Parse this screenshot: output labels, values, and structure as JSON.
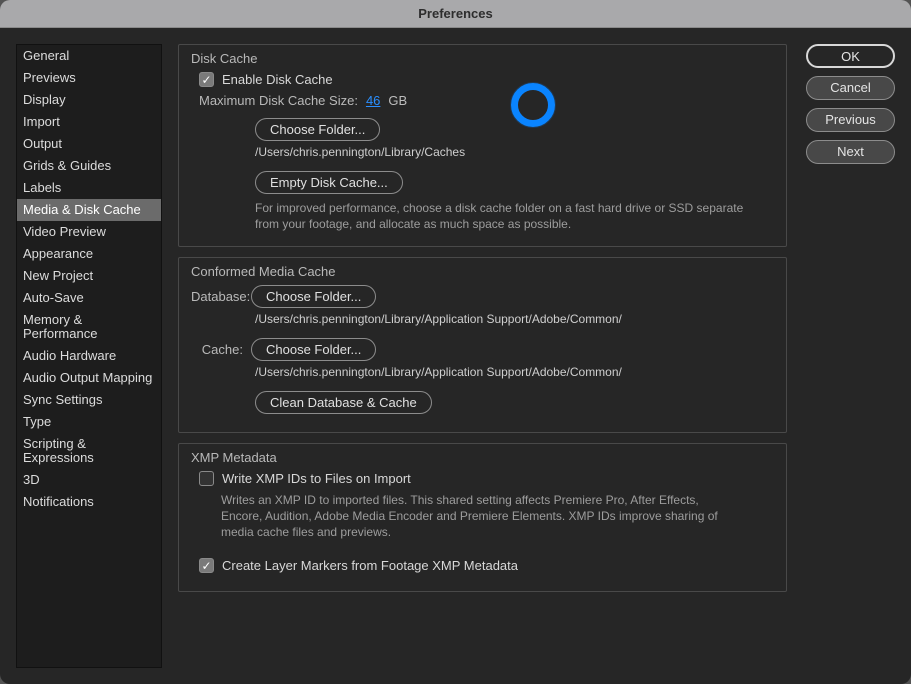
{
  "title": "Preferences",
  "sidebar": {
    "items": [
      {
        "label": "General"
      },
      {
        "label": "Previews"
      },
      {
        "label": "Display"
      },
      {
        "label": "Import"
      },
      {
        "label": "Output"
      },
      {
        "label": "Grids & Guides"
      },
      {
        "label": "Labels"
      },
      {
        "label": "Media & Disk Cache",
        "selected": true
      },
      {
        "label": "Video Preview"
      },
      {
        "label": "Appearance"
      },
      {
        "label": "New Project"
      },
      {
        "label": "Auto-Save"
      },
      {
        "label": "Memory & Performance"
      },
      {
        "label": "Audio Hardware"
      },
      {
        "label": "Audio Output Mapping"
      },
      {
        "label": "Sync Settings"
      },
      {
        "label": "Type"
      },
      {
        "label": "Scripting & Expressions"
      },
      {
        "label": "3D"
      },
      {
        "label": "Notifications"
      }
    ]
  },
  "buttons": {
    "ok": "OK",
    "cancel": "Cancel",
    "previous": "Previous",
    "next": "Next"
  },
  "diskCache": {
    "title": "Disk Cache",
    "enable_label": "Enable Disk Cache",
    "enable_checked": true,
    "max_label": "Maximum Disk Cache Size:",
    "size_value": "46",
    "size_unit": "GB",
    "choose_folder": "Choose Folder...",
    "path": "/Users/chris.pennington/Library/Caches",
    "empty": "Empty Disk Cache...",
    "hint": "For improved performance, choose a disk cache folder on a fast hard drive or SSD separate from your footage, and allocate as much space as possible."
  },
  "conformed": {
    "title": "Conformed Media Cache",
    "database_label": "Database:",
    "database_choose": "Choose Folder...",
    "database_path": "/Users/chris.pennington/Library/Application Support/Adobe/Common/",
    "cache_label": "Cache:",
    "cache_choose": "Choose Folder...",
    "cache_path": "/Users/chris.pennington/Library/Application Support/Adobe/Common/",
    "clean": "Clean Database & Cache"
  },
  "xmp": {
    "title": "XMP Metadata",
    "write_label": "Write XMP IDs to Files on Import",
    "write_checked": false,
    "write_hint": "Writes an XMP ID to imported files. This shared setting affects Premiere Pro, After Effects, Encore, Audition, Adobe Media Encoder and Premiere Elements. XMP IDs improve sharing of media cache files and previews.",
    "markers_label": "Create Layer Markers from Footage XMP Metadata",
    "markers_checked": true
  }
}
